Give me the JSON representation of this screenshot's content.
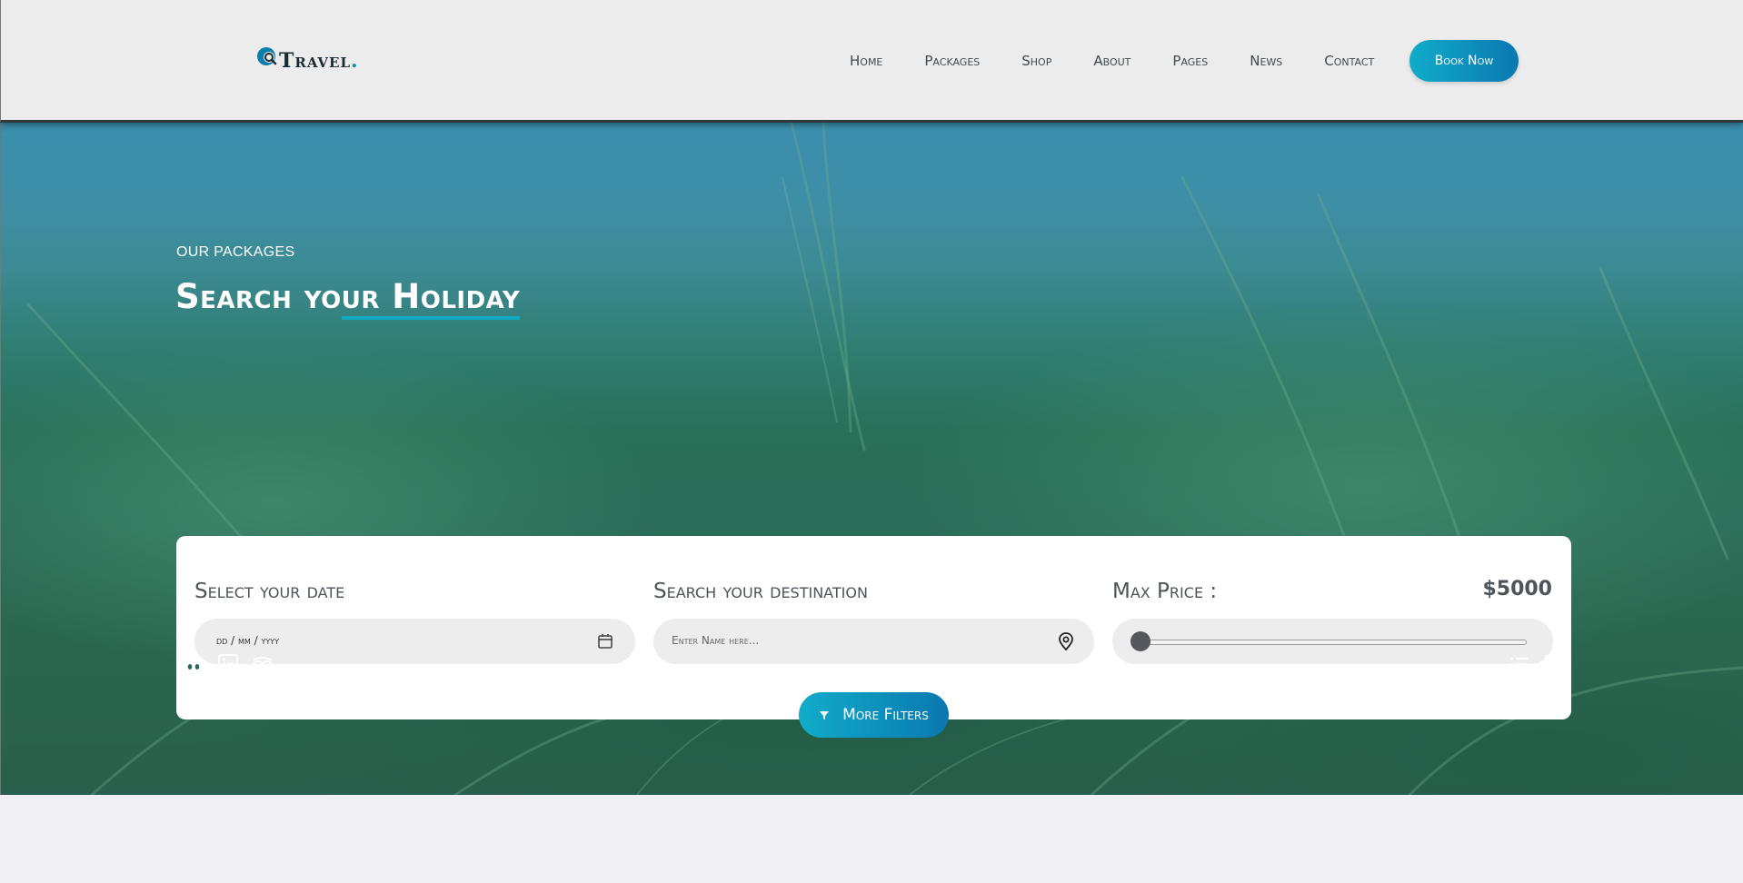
{
  "brand": {
    "name": "Travel",
    "dot": "."
  },
  "nav": {
    "items": [
      "Home",
      "Packages",
      "Shop",
      "About",
      "Pages",
      "News",
      "Contact"
    ],
    "cta": "Book Now"
  },
  "hero": {
    "eyebrow": "OUR PACKAGES",
    "title_start": "Search yo",
    "title_underlined": "ur Holiday"
  },
  "search": {
    "date": {
      "label": "Select your date",
      "placeholder": "dd / mm / yyyy",
      "icon": "calendar-icon"
    },
    "destination": {
      "label": "Search your destination",
      "placeholder": "Enter Name here...",
      "icon": "map-pin-icon"
    },
    "price": {
      "label": "Max Price :",
      "value": "$5000",
      "slider_fraction": 0
    },
    "more_filters": "More Filters"
  },
  "social_icons": [
    "github-icon",
    "linkedin-icon",
    "tripadvisor-icon"
  ],
  "view_icons": [
    "list-view-icon",
    "grid-view-icon"
  ],
  "colors": {
    "accent_start": "#11acc9",
    "accent_end": "#0a78b0",
    "header_bg": "#ececec",
    "page_bg": "#efeff4",
    "text_dark": "#4d545a"
  }
}
